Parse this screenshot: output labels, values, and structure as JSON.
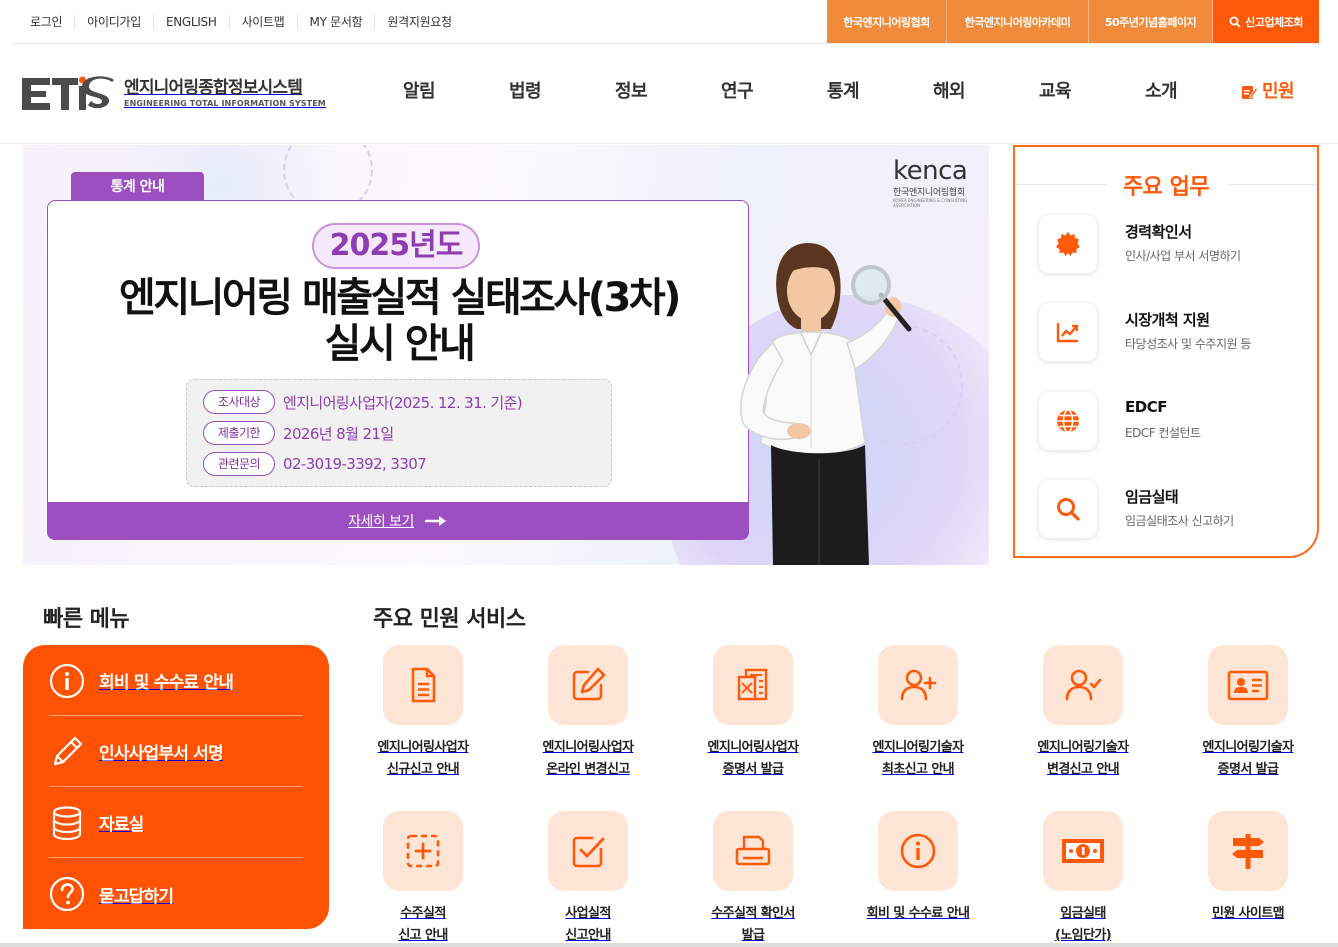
{
  "util": {
    "left_links": [
      "로그인",
      "아이디가입",
      "ENGLISH",
      "사이트맵",
      "MY 문서함",
      "원격지원요청"
    ],
    "right_links": [
      "한국엔지니어링협회",
      "한국엔지니어링아카데미",
      "50주년기념홈페이지"
    ],
    "search_link": "신고업체조회"
  },
  "logo": {
    "mark": "ETIS",
    "korean": "엔지니어링종합정보시스템",
    "english": "ENGINEERING TOTAL INFORMATION SYSTEM"
  },
  "nav": [
    "알림",
    "법령",
    "정보",
    "연구",
    "통계",
    "해외",
    "교육",
    "소개"
  ],
  "nav_accent": "민원",
  "banner": {
    "tag": "통계 안내",
    "brand_word": "kenca",
    "brand_korean": "한국엔지니어링협회",
    "brand_english": "KOREA ENGINEERING & CONSULTING ASSOCIATION",
    "year": "2025년도",
    "headline_line1": "엔지니어링 매출실적 실태조사(3차)",
    "headline_line2": "실시 안내",
    "rows": [
      {
        "label": "조사대상",
        "value": "엔지니어링사업자(2025. 12. 31. 기준)"
      },
      {
        "label": "제출기한",
        "value": "2026년 8월 21일"
      },
      {
        "label": "관련문의",
        "value": "02-3019-3392, 3307"
      }
    ],
    "more": "자세히 보기"
  },
  "tasks": {
    "title": "주요 업무",
    "items": [
      {
        "name": "경력확인서",
        "desc": "인사/사업 부서 서명하기",
        "icon": "badge-icon"
      },
      {
        "name": "시장개척 지원",
        "desc": "타당성조사 및 수주지원 등",
        "icon": "chart-icon"
      },
      {
        "name": "EDCF",
        "desc": "EDCF 컨설턴트",
        "icon": "globe-icon"
      },
      {
        "name": "임금실태",
        "desc": "임금실태조사 신고하기",
        "icon": "search-icon"
      }
    ]
  },
  "quick": {
    "title": "빠른 메뉴",
    "items": [
      "회비 및 수수료 안내",
      "인사사업부서 서명",
      "자료실",
      "묻고답하기"
    ]
  },
  "services": {
    "title": "주요 민원 서비스",
    "items": [
      {
        "label": "엔지니어링사업자\n신규신고 안내",
        "icon": "document-icon"
      },
      {
        "label": "엔지니어링사업자\n온라인 변경신고",
        "icon": "edit-icon"
      },
      {
        "label": "엔지니어링사업자\n증명서 발급",
        "icon": "certificate-icon"
      },
      {
        "label": "엔지니어링기술자\n최초신고 안내",
        "icon": "user-plus-icon"
      },
      {
        "label": "엔지니어링기술자\n변경신고 안내",
        "icon": "user-check-icon"
      },
      {
        "label": "엔지니어링기술자\n증명서 발급",
        "icon": "id-card-icon"
      },
      {
        "label": "수주실적\n신고 안내",
        "icon": "add-box-icon"
      },
      {
        "label": "사업실적\n신고안내",
        "icon": "checkbox-icon"
      },
      {
        "label": "수주실적 확인서\n발급",
        "icon": "printer-icon"
      },
      {
        "label": "회비 및 수수료 안내",
        "icon": "info-icon"
      },
      {
        "label": "임금실태\n(노임단가)",
        "icon": "money-icon"
      },
      {
        "label": "민원 사이트맵",
        "icon": "signpost-icon"
      }
    ]
  },
  "colors": {
    "orange": "#ff5a0a",
    "purple": "#9b4fc0",
    "light_orange": "#ffe5d6"
  }
}
